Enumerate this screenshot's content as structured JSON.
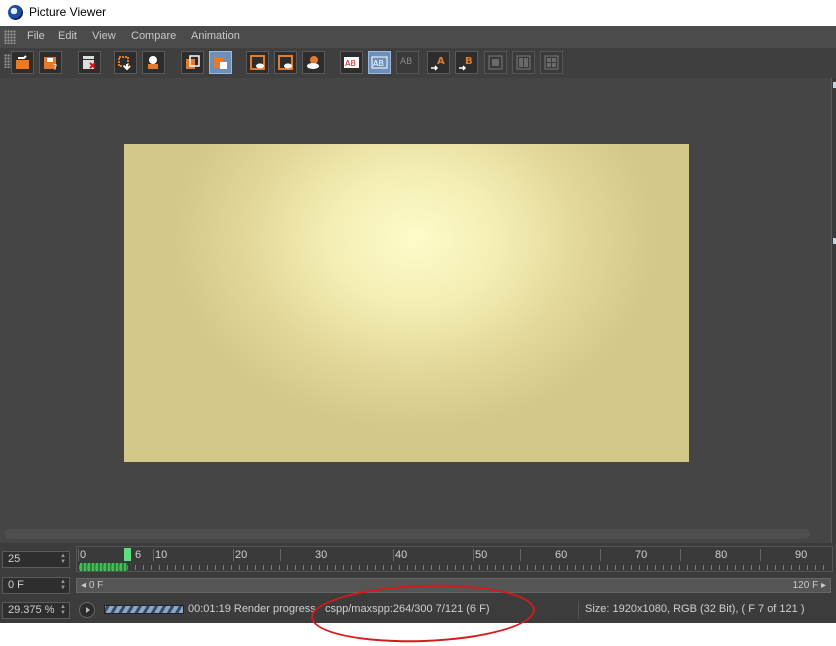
{
  "window": {
    "title": "Picture Viewer"
  },
  "menubar": {
    "items": [
      "File",
      "Edit",
      "View",
      "Compare",
      "Animation"
    ]
  },
  "toolbar": {
    "buttons": [
      {
        "name": "open-icon"
      },
      {
        "name": "save-icon"
      },
      {
        "name": "clapper-icon"
      },
      {
        "name": "export-icon"
      },
      {
        "name": "user-render-icon"
      },
      {
        "name": "copy-frame-icon"
      },
      {
        "name": "film-strip-icon"
      },
      {
        "name": "region-a-icon"
      },
      {
        "name": "region-b-icon"
      },
      {
        "name": "eye-compare-icon"
      },
      {
        "name": "ab-label-icon"
      },
      {
        "name": "ab-split-icon"
      },
      {
        "name": "ab-disabled-icon"
      },
      {
        "name": "set-a-icon",
        "label": "A"
      },
      {
        "name": "set-b-icon",
        "label": "B"
      },
      {
        "name": "layout-1-icon"
      },
      {
        "name": "layout-2-icon"
      },
      {
        "name": "layout-3-icon"
      }
    ]
  },
  "timeline": {
    "fps": "25",
    "ticks": [
      "0",
      "6",
      "10",
      "20",
      "30",
      "40",
      "50",
      "60",
      "70",
      "80",
      "90"
    ],
    "current_frame_field": "0 F",
    "range_start": "0 F",
    "range_end": "120 F"
  },
  "status": {
    "zoom": "29.375 %",
    "elapsed": "00:01:19 Render progress",
    "render_info": "cspp/maxspp:264/300 7/121 (6 F)",
    "size_info": "Size: 1920x1080, RGB (32 Bit),  ( F 7 of 121 )"
  },
  "colors": {
    "annotation": "#d8191a",
    "accent_select": "#6e8fb8",
    "frame_marker": "#5ee080"
  }
}
